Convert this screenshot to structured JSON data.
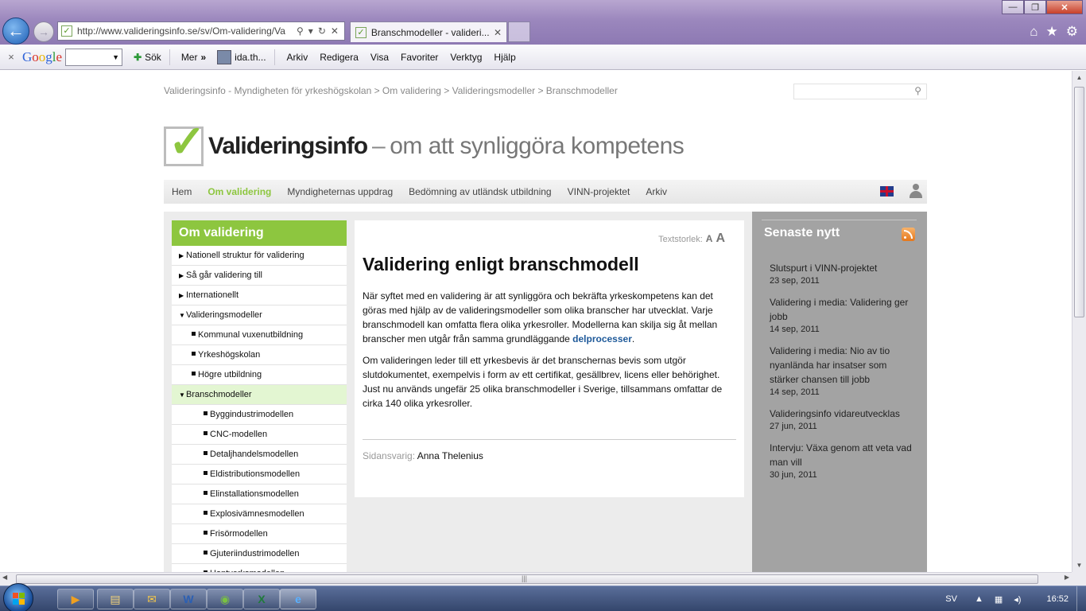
{
  "browser": {
    "address_url": "http://www.valideringsinfo.se/sv/Om-validering/Va",
    "tab_title": "Branschmodeller - valideri...",
    "window_buttons": {
      "minimize": "—",
      "maximize": "❐",
      "close": "✕"
    },
    "right_icons": {
      "home": "⌂",
      "favorites": "★",
      "tools": "⚙"
    }
  },
  "toolbar": {
    "close_glyph": "×",
    "google_letters": [
      "G",
      "o",
      "o",
      "g",
      "l",
      "e"
    ],
    "sok_label": "Sök",
    "mer_label": "Mer",
    "mer_glyph": "»",
    "user_label": "ida.th...",
    "menu": [
      "Arkiv",
      "Redigera",
      "Visa",
      "Favoriter",
      "Verktyg",
      "Hjälp"
    ]
  },
  "breadcrumb": "Valideringsinfo - Myndigheten för yrkeshögskolan > Om validering > Valideringsmodeller > Branschmodeller",
  "site": {
    "brand": "Valideringsinfo",
    "dash": "–",
    "tagline": "om att synliggöra kompetens"
  },
  "mainnav": [
    {
      "label": "Hem",
      "active": false
    },
    {
      "label": "Om validering",
      "active": true
    },
    {
      "label": "Myndigheternas uppdrag",
      "active": false
    },
    {
      "label": "Bedömning av utländsk utbildning",
      "active": false
    },
    {
      "label": "VINN-projektet",
      "active": false
    },
    {
      "label": "Arkiv",
      "active": false
    }
  ],
  "sidebar": {
    "heading": "Om validering",
    "items": [
      {
        "label": "Nationell struktur för validering",
        "level": 1,
        "marker": "▶"
      },
      {
        "label": "Så går validering till",
        "level": 1,
        "marker": "▶"
      },
      {
        "label": "Internationellt",
        "level": 1,
        "marker": "▶"
      },
      {
        "label": "Valideringsmodeller",
        "level": 1,
        "marker": "▼"
      },
      {
        "label": "Kommunal vuxenutbildning",
        "level": 2,
        "marker": "■"
      },
      {
        "label": "Yrkeshögskolan",
        "level": 2,
        "marker": "■"
      },
      {
        "label": "Högre utbildning",
        "level": 2,
        "marker": "■"
      },
      {
        "label": "Branschmodeller",
        "level": 1,
        "marker": "▼",
        "active": true
      },
      {
        "label": "Byggindustrimodellen",
        "level": 3,
        "marker": "■"
      },
      {
        "label": "CNC-modellen",
        "level": 3,
        "marker": "■"
      },
      {
        "label": "Detaljhandelsmodellen",
        "level": 3,
        "marker": "■"
      },
      {
        "label": "Eldistributionsmodellen",
        "level": 3,
        "marker": "■"
      },
      {
        "label": "Elinstallationsmodellen",
        "level": 3,
        "marker": "■"
      },
      {
        "label": "Explosivämnesmodellen",
        "level": 3,
        "marker": "■"
      },
      {
        "label": "Frisörmodellen",
        "level": 3,
        "marker": "■"
      },
      {
        "label": "Gjuteriindustrimodellen",
        "level": 3,
        "marker": "■"
      },
      {
        "label": "Hantverksmodellen",
        "level": 3,
        "marker": "■"
      }
    ]
  },
  "article": {
    "textsize_label": "Textstorlek:",
    "textsize_small": "A",
    "textsize_large": "A",
    "title": "Validering enligt branschmodell",
    "p1": "När syftet med en validering är att synliggöra och bekräfta yrkeskompetens kan det göras med hjälp av de valideringsmodeller som olika branscher har utvecklat. Varje branschmodell kan omfatta flera olika yrkesroller. Modellerna kan skilja sig åt mellan branscher men utgår från samma grundläggande ",
    "p1_link": "delprocesser",
    "p1_end": ".",
    "p2": "Om valideringen leder till ett yrkesbevis är det branschernas bevis som utgör slutdokumentet, exempelvis i form av ett certifikat, gesällbrev, licens eller behörighet. Just nu används ungefär 25 olika branschmodeller i Sverige, tillsammans omfattar de cirka 140 olika yrkesroller.",
    "responsible_label": "Sidansvarig:",
    "responsible_name": "Anna Thelenius"
  },
  "news": {
    "heading": "Senaste nytt",
    "items": [
      {
        "title": "Slutspurt i VINN-projektet",
        "date": "23 sep, 2011"
      },
      {
        "title": "Validering i media: Validering ger jobb",
        "date": "14 sep, 2011"
      },
      {
        "title": "Validering i media: Nio av tio nyanlända har insatser som stärker chansen till jobb",
        "date": "14 sep, 2011"
      },
      {
        "title": "Valideringsinfo vidareutvecklas",
        "date": "27 jun, 2011"
      },
      {
        "title": "Intervju: Växa genom att veta vad man vill",
        "date": "30 jun, 2011"
      }
    ]
  },
  "taskbar": {
    "language": "SV",
    "clock": "16:52"
  },
  "colors": {
    "accent_green": "#8dc63f",
    "active_sidebar_bg": "#e3f6d2",
    "news_panel_bg": "#a3a3a3",
    "link_blue": "#1f5a9a"
  }
}
